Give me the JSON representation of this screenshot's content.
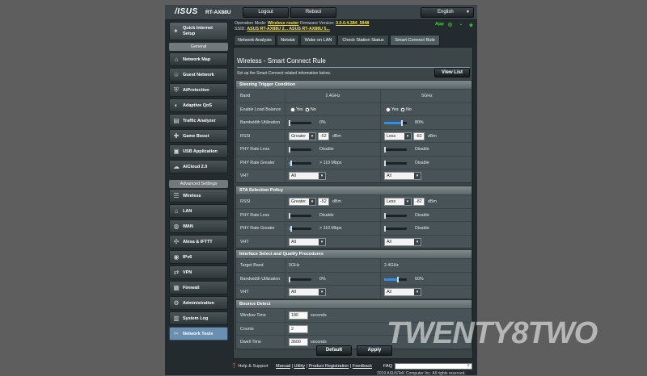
{
  "header": {
    "brand": "/ISUS",
    "model": "RT-AX88U",
    "logout": "Logout",
    "reboot": "Reboot",
    "language": "English"
  },
  "status": {
    "op_mode_label": "Operation Mode:",
    "op_mode_value": "Wireless router",
    "firmware_label": "Firmware Version:",
    "firmware_value": "3.0.0.4.384_5948",
    "ssid_label": "SSID:",
    "ssid_values": "ASUS RT-AX88U 2...  ASUS RT-AX88U 5...",
    "app_label": "App"
  },
  "sidebar": {
    "quick_setup": "Quick Internet Setup",
    "general_header": "General",
    "general": [
      {
        "label": "Network Map",
        "icon": "network-map-icon"
      },
      {
        "label": "Guest Network",
        "icon": "guest-network-icon"
      },
      {
        "label": "AiProtection",
        "icon": "aiprotection-icon"
      },
      {
        "label": "Adaptive QoS",
        "icon": "qos-icon"
      },
      {
        "label": "Traffic Analyzer",
        "icon": "traffic-analyzer-icon"
      },
      {
        "label": "Game Boost",
        "icon": "game-boost-icon"
      },
      {
        "label": "USB Application",
        "icon": "usb-icon"
      },
      {
        "label": "AiCloud 2.0",
        "icon": "cloud-icon"
      }
    ],
    "advanced_header": "Advanced Settings",
    "advanced": [
      {
        "label": "Wireless",
        "icon": "wireless-icon"
      },
      {
        "label": "LAN",
        "icon": "lan-icon"
      },
      {
        "label": "WAN",
        "icon": "wan-icon"
      },
      {
        "label": "Alexa & IFTTT",
        "icon": "alexa-icon"
      },
      {
        "label": "IPv6",
        "icon": "ipv6-icon"
      },
      {
        "label": "VPN",
        "icon": "vpn-icon"
      },
      {
        "label": "Firewall",
        "icon": "firewall-icon"
      },
      {
        "label": "Administration",
        "icon": "administration-icon"
      },
      {
        "label": "System Log",
        "icon": "system-log-icon"
      },
      {
        "label": "Network Tools",
        "icon": "network-tools-icon"
      }
    ]
  },
  "tabs": [
    "Network Analysis",
    "Netstat",
    "Wake on LAN",
    "Check Station Status",
    "Smart Connect Rule"
  ],
  "panel": {
    "title": "Wireless - Smart Connect Rule",
    "description": "Set up the Smart Connect related information below.",
    "view_list": "View List"
  },
  "steering": {
    "header": "Steering Trigger Condition",
    "band_label": "Band",
    "band_24": "2.4GHz",
    "band_5": "5GHz",
    "load_balance_label": "Enable Load Balance",
    "yes": "Yes",
    "no": "No",
    "bw_label": "Bandwidth Utilization",
    "bw_24": "0%",
    "bw_5": "80%",
    "rssi_label": "RSSI",
    "rssi_24_op": "Greater",
    "rssi_24_val": "-52",
    "rssi_5_op": "Less",
    "rssi_5_val": "-82",
    "dbm": "dBm",
    "phy_less_label": "PHY Rate Less",
    "phy_less_24": "Disable",
    "phy_less_5": "Disable",
    "phy_greater_label": "PHY Rate Greater",
    "phy_greater_24": "> 110 Mbps",
    "phy_greater_5": "Disable",
    "vht_label": "VHT",
    "vht_24": "All",
    "vht_5": "All"
  },
  "sta": {
    "header": "STA Selection Policy",
    "rssi_label": "RSSI",
    "rssi_24_op": "Greater",
    "rssi_24_val": "-52",
    "rssi_5_op": "Less",
    "rssi_5_val": "-82",
    "dbm": "dBm",
    "phy_less_label": "PHY Rate Less",
    "phy_less_24": "Disable",
    "phy_less_5": "Disable",
    "phy_greater_label": "PHY Rate Greater",
    "phy_greater_24": "> 110 Mbps",
    "phy_greater_5": "Disable",
    "vht_label": "VHT",
    "vht_24": "All",
    "vht_5": "All"
  },
  "iface": {
    "header": "Interface Select and Qualify Procedures",
    "target_label": "Target Band",
    "target_24": "5GHz",
    "target_5": "2.4GHz",
    "bw_label": "Bandwidth Utilization",
    "bw_24": "0%",
    "bw_5": "60%",
    "vht_label": "VHT",
    "vht_24": "All",
    "vht_5": "All"
  },
  "bounce": {
    "header": "Bounce Detect",
    "window_label": "Window Time",
    "window_val": "180",
    "counts_label": "Counts",
    "counts_val": "2",
    "dwell_label": "Dwell Time",
    "dwell_val": "3600",
    "seconds": "seconds"
  },
  "buttons": {
    "default": "Default",
    "apply": "Apply"
  },
  "footer": {
    "help": "Help & Support",
    "manual": "Manual",
    "utility": "Utility",
    "product_reg": "Product Registration",
    "feedback": "Feedback",
    "faq": "FAQ",
    "copyright": "2019 ASUSTeK Computer Inc. All rights reserved."
  },
  "watermark": "TWENTY8TWO",
  "colors": {
    "accent": "#2f8ff0",
    "active_nav": "#6a8fb0",
    "highlight": "#f7e14b",
    "status_green": "#46d146"
  }
}
